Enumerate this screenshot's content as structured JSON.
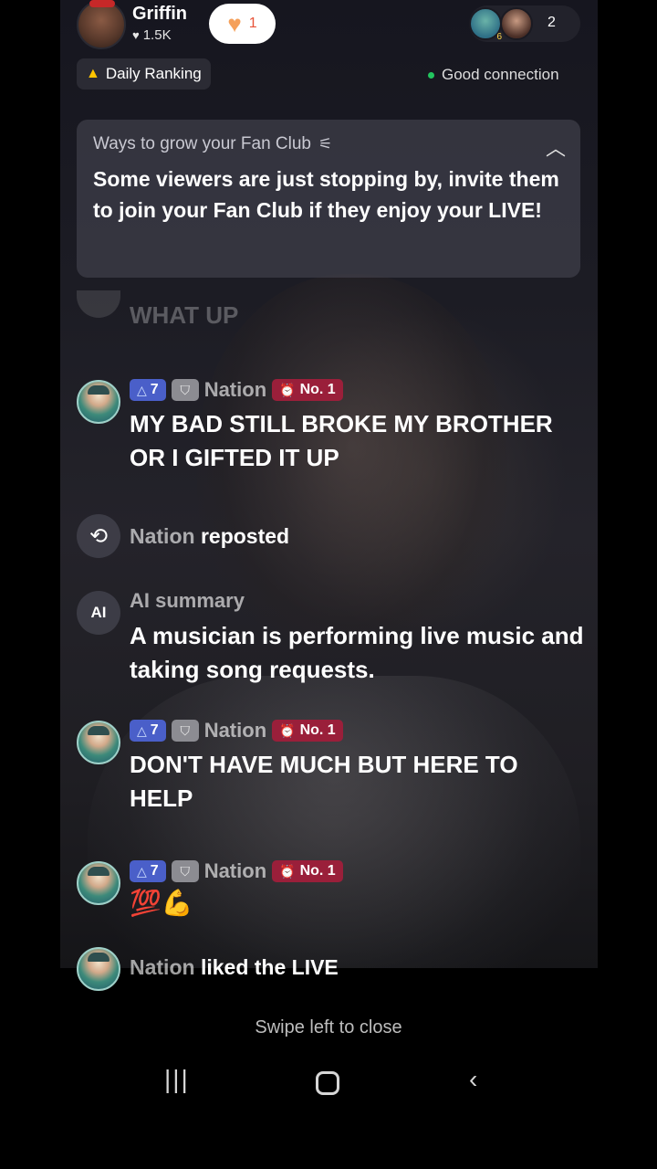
{
  "header": {
    "host_name": "Griffin",
    "host_likes": "1.5K",
    "heart_count": "1",
    "viewer_count": "2",
    "viewer_badge": "6",
    "daily_ranking": "Daily Ranking",
    "connection_status": "Good connection",
    "connection_color": "#22c55e"
  },
  "fan_club_card": {
    "title": "Ways to grow your Fan Club",
    "body": "Some viewers are just stopping by, invite them to join your Fan Club if they enjoy your LIVE!"
  },
  "chat": {
    "faded_message": "WHAT UP",
    "messages": [
      {
        "level": "7",
        "user": "Nation",
        "rank": "No. 1",
        "text": "MY BAD STILL BROKE MY BROTHER OR I GIFTED IT UP"
      },
      {
        "level": "7",
        "user": "Nation",
        "rank": "No. 1",
        "text": "DON'T HAVE MUCH BUT HERE TO HELP"
      },
      {
        "level": "7",
        "user": "Nation",
        "rank": "No. 1",
        "text": "💯💪"
      }
    ],
    "repost": {
      "user": "Nation",
      "action": "reposted"
    },
    "ai_summary": {
      "label": "AI summary",
      "text": "A musician is performing live music and taking song requests."
    },
    "liked": {
      "user": "Nation",
      "action": "liked the LIVE"
    }
  },
  "footer": {
    "swipe_hint": "Swipe left to close"
  },
  "icons": [
    "heart-icon",
    "fire-icon",
    "tune-icon",
    "chevron-up-icon",
    "repost-icon",
    "ai-icon",
    "level-triangle-icon",
    "shield-icon",
    "clock-icon",
    "recent-apps-icon",
    "home-icon",
    "back-icon"
  ]
}
